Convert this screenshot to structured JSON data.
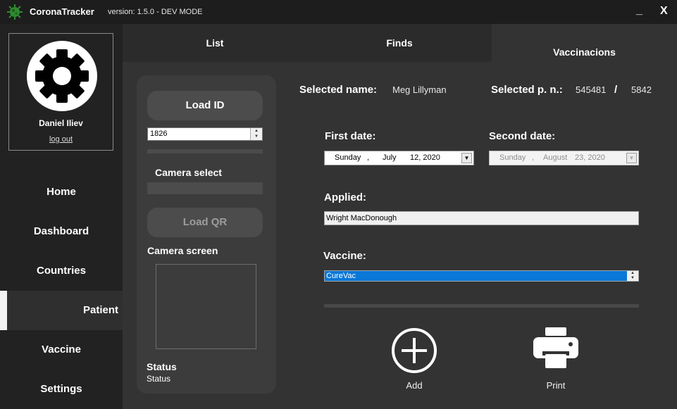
{
  "app": {
    "title": "CoronaTracker",
    "version": "version: 1.5.0 - DEV MODE",
    "minimize": "_",
    "close": "X"
  },
  "user": {
    "name": "Daniel Iliev",
    "logout": "log out",
    "avatar_icon": "gear-icon"
  },
  "nav": [
    {
      "label": "Home"
    },
    {
      "label": "Dashboard"
    },
    {
      "label": "Countries"
    },
    {
      "label": "Patient",
      "active": true
    },
    {
      "label": "Vaccine"
    },
    {
      "label": "Settings"
    }
  ],
  "tabs": [
    {
      "label": "List"
    },
    {
      "label": "Finds"
    },
    {
      "label": "Vaccinacions",
      "active": true
    }
  ],
  "panel": {
    "load_id": "Load ID",
    "id_value": "1826",
    "camera_select": "Camera select",
    "load_qr": "Load QR",
    "camera_screen": "Camera screen",
    "status_title": "Status",
    "status_value": "Status"
  },
  "selected": {
    "name_label": "Selected name:",
    "name_value": "Meg Lillyman",
    "pn_label": "Selected p. n.:",
    "pn_value1": "545481",
    "pn_sep": "/",
    "pn_value2": "5842"
  },
  "first_date": {
    "label": "First date:",
    "weekday": "Sunday",
    "comma": ",",
    "month": "July",
    "day_year": "12, 2020"
  },
  "second_date": {
    "label": "Second date:",
    "weekday": "Sunday",
    "comma": ",",
    "month": "August",
    "day_year": "23, 2020",
    "enabled": false
  },
  "applied": {
    "label": "Applied:",
    "value": "Wright MacDonough"
  },
  "vaccine": {
    "label": "Vaccine:",
    "value": "CureVac"
  },
  "actions": {
    "add": "Add",
    "print": "Print"
  },
  "colors": {
    "background": "#333333",
    "sidebar": "#222222",
    "selection": "#0a78d7",
    "logo": "#2e8b2e"
  }
}
